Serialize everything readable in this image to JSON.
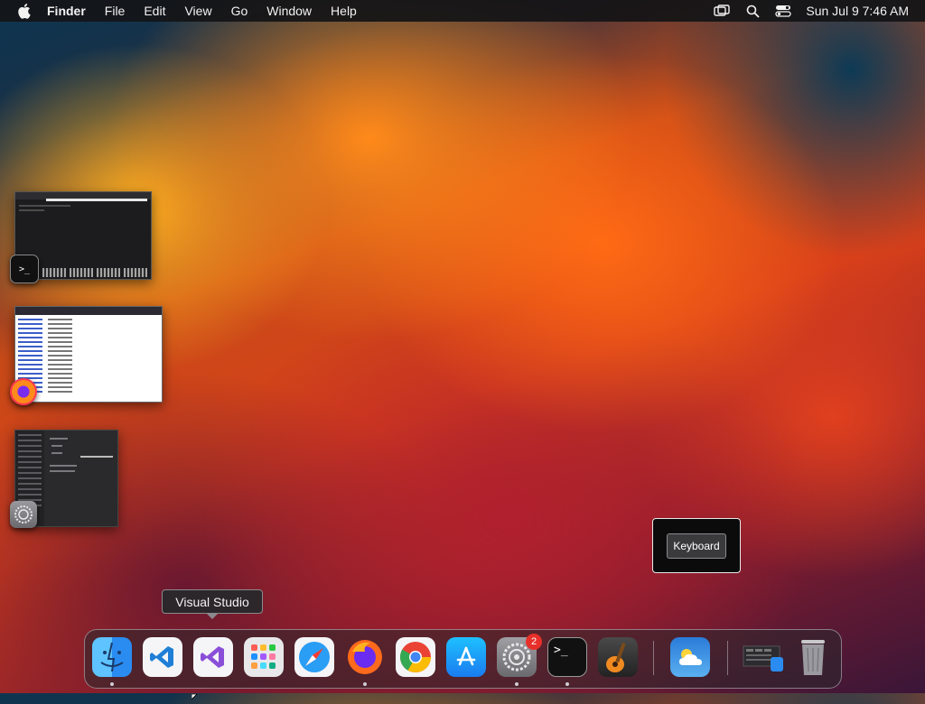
{
  "menubar": {
    "app_name": "Finder",
    "items": [
      "File",
      "Edit",
      "View",
      "Go",
      "Window",
      "Help"
    ],
    "clock": "Sun Jul 9  7:46 AM",
    "status_icons": [
      "screen-mirroring-icon",
      "search-icon",
      "control-center-icon"
    ]
  },
  "tooltip": {
    "text": "Visual Studio"
  },
  "keyboard_popup": {
    "button_label": "Keyboard"
  },
  "thumbnails": [
    "Terminal",
    "Firefox",
    "System Settings"
  ],
  "dock": {
    "apps": [
      "Finder",
      "Visual Studio Code",
      "Visual Studio",
      "Launchpad",
      "Safari",
      "Firefox",
      "Google Chrome",
      "App Store",
      "System Settings",
      "Terminal",
      "GarageBand",
      "Weather",
      "Downloads",
      "Trash"
    ],
    "notification_count": "2"
  },
  "colors": {
    "menubar_bg": "#141416",
    "badge_red": "#e8302a"
  }
}
